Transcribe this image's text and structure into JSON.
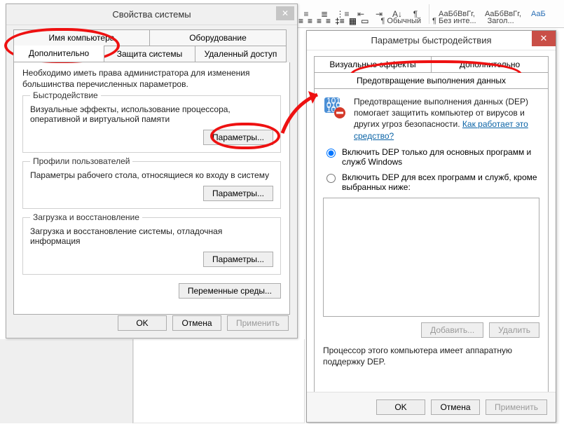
{
  "ribbon": {
    "style1": "АаБбВвГг,",
    "style2": "АаБбВвГг,",
    "style3": "АаБ",
    "normal": "¶ Обычный",
    "nospace": "¶ Без инте...",
    "heading": "Загол..."
  },
  "dlg1": {
    "title": "Свойства системы",
    "tabs": {
      "computer_name": "Имя компьютера",
      "hardware": "Оборудование",
      "advanced": "Дополнительно",
      "protection": "Защита системы",
      "remote": "Удаленный доступ"
    },
    "intro": "Необходимо иметь права администратора для изменения большинства перечисленных параметров.",
    "perf": {
      "title": "Быстродействие",
      "text": "Визуальные эффекты, использование процессора, оперативной и виртуальной памяти",
      "button": "Параметры..."
    },
    "profiles": {
      "title": "Профили пользователей",
      "text": "Параметры рабочего стола, относящиеся ко входу в систему",
      "button": "Параметры..."
    },
    "startup": {
      "title": "Загрузка и восстановление",
      "text": "Загрузка и восстановление системы, отладочная информация",
      "button": "Параметры..."
    },
    "envvars": "Переменные среды...",
    "ok": "OK",
    "cancel": "Отмена",
    "apply": "Применить"
  },
  "dlg2": {
    "title": "Параметры быстродействия",
    "tabs": {
      "visual": "Визуальные эффекты",
      "advanced": "Дополнительно",
      "dep": "Предотвращение выполнения данных"
    },
    "dep_text1": "Предотвращение выполнения данных (DEP) помогает защитить компьютер от вирусов и других угроз безопасности. ",
    "dep_link": "Как работает это средство?",
    "radio1": "Включить DEP только для основных программ и служб Windows",
    "radio2": "Включить DEP для всех программ и служб, кроме выбранных ниже:",
    "add": "Добавить...",
    "delete": "Удалить",
    "procnote": "Процессор этого компьютера имеет аппаратную поддержку DEP.",
    "ok": "OK",
    "cancel": "Отмена",
    "apply": "Применить"
  }
}
